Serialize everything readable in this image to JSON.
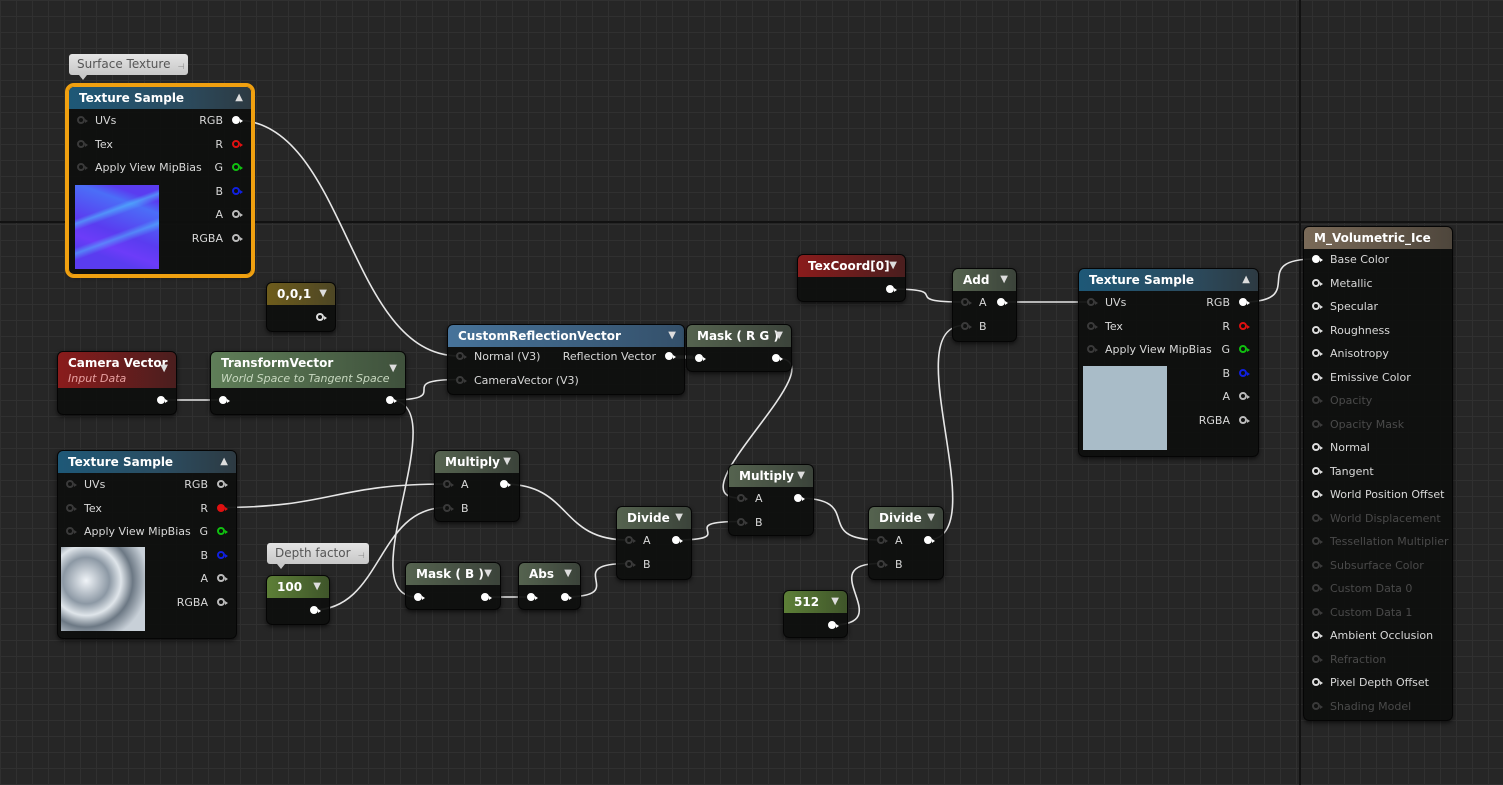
{
  "editor": {
    "type": "material-graph"
  },
  "colors": {
    "selection": "#f0a010",
    "wire": "#e6e6e6",
    "background": "#262626"
  },
  "nodes": [
    {
      "id": "ts1",
      "kind": "texture",
      "title": "Texture Sample",
      "comment": "Surface Texture",
      "selected": true,
      "collapse_icon": "triangle-up-icon",
      "inputs": [
        {
          "label": "UVs"
        },
        {
          "label": "Tex"
        },
        {
          "label": "Apply View MipBias"
        }
      ],
      "outputs": [
        {
          "label": "RGB",
          "color": "white",
          "connected": true
        },
        {
          "label": "R",
          "color": "red"
        },
        {
          "label": "G",
          "color": "green"
        },
        {
          "label": "B",
          "color": "blue"
        },
        {
          "label": "A",
          "color": "gray"
        },
        {
          "label": "RGBA",
          "color": "gray"
        }
      ],
      "preview": "normal-map"
    },
    {
      "id": "c001",
      "kind": "const3",
      "title": "0,0,1",
      "inputs": [],
      "outputs": [
        {
          "label": "",
          "color": "white"
        }
      ]
    },
    {
      "id": "cam",
      "kind": "red",
      "title": "Camera Vector",
      "subtitle": "Input Data",
      "inputs": [],
      "outputs": [
        {
          "label": "",
          "color": "white",
          "connected": true
        }
      ]
    },
    {
      "id": "tv",
      "kind": "green",
      "title": "TransformVector",
      "subtitle": "World Space to Tangent Space",
      "inputs": [
        {
          "label": "",
          "connected": true
        }
      ],
      "outputs": [
        {
          "label": "",
          "color": "white",
          "connected": true
        }
      ]
    },
    {
      "id": "crv",
      "kind": "crv",
      "title": "CustomReflectionVector",
      "inputs": [
        {
          "label": "Normal (V3)"
        },
        {
          "label": "CameraVector (V3)"
        }
      ],
      "outputs": [
        {
          "label": "Reflection Vector",
          "color": "white",
          "connected": true
        }
      ]
    },
    {
      "id": "maskrg",
      "kind": "math",
      "title": "Mask ( R G )",
      "inputs": [
        {
          "label": "",
          "connected": true
        }
      ],
      "outputs": [
        {
          "label": "",
          "color": "white",
          "connected": true
        }
      ]
    },
    {
      "id": "texcoord",
      "kind": "red",
      "title": "TexCoord[0]",
      "inputs": [],
      "outputs": [
        {
          "label": "",
          "color": "white",
          "connected": true
        }
      ]
    },
    {
      "id": "add",
      "kind": "math",
      "title": "Add",
      "inputs": [
        {
          "label": "A"
        },
        {
          "label": "B"
        }
      ],
      "outputs": [
        {
          "label": "",
          "color": "white",
          "connected": true
        }
      ]
    },
    {
      "id": "ts2",
      "kind": "texture",
      "title": "Texture Sample",
      "collapse_icon": "triangle-up-icon",
      "inputs": [
        {
          "label": "UVs"
        },
        {
          "label": "Tex"
        },
        {
          "label": "Apply View MipBias"
        }
      ],
      "outputs": [
        {
          "label": "RGB",
          "color": "white",
          "connected": true
        },
        {
          "label": "R",
          "color": "red"
        },
        {
          "label": "G",
          "color": "green"
        },
        {
          "label": "B",
          "color": "blue"
        },
        {
          "label": "A",
          "color": "gray"
        },
        {
          "label": "RGBA",
          "color": "gray"
        }
      ],
      "preview": "flat-blue-gray"
    },
    {
      "id": "ts3",
      "kind": "texture",
      "title": "Texture Sample",
      "collapse_icon": "triangle-up-icon",
      "inputs": [
        {
          "label": "UVs"
        },
        {
          "label": "Tex"
        },
        {
          "label": "Apply View MipBias"
        }
      ],
      "outputs": [
        {
          "label": "RGB",
          "color": "gray"
        },
        {
          "label": "R",
          "color": "red",
          "connected": true
        },
        {
          "label": "G",
          "color": "green"
        },
        {
          "label": "B",
          "color": "blue"
        },
        {
          "label": "A",
          "color": "gray"
        },
        {
          "label": "RGBA",
          "color": "gray"
        }
      ],
      "preview": "ice"
    },
    {
      "id": "c100",
      "kind": "const1",
      "title": "100",
      "comment": "Depth factor",
      "inputs": [],
      "outputs": [
        {
          "label": "",
          "color": "white",
          "connected": true
        }
      ]
    },
    {
      "id": "mul1",
      "kind": "math",
      "title": "Multiply",
      "inputs": [
        {
          "label": "A"
        },
        {
          "label": "B"
        }
      ],
      "outputs": [
        {
          "label": "",
          "color": "white",
          "connected": true
        }
      ]
    },
    {
      "id": "maskb",
      "kind": "math",
      "title": "Mask ( B )",
      "inputs": [
        {
          "label": "",
          "connected": true
        }
      ],
      "outputs": [
        {
          "label": "",
          "color": "white",
          "connected": true
        }
      ]
    },
    {
      "id": "abs",
      "kind": "math",
      "title": "Abs",
      "inputs": [
        {
          "label": "",
          "connected": true
        }
      ],
      "outputs": [
        {
          "label": "",
          "color": "white",
          "connected": true
        }
      ]
    },
    {
      "id": "div1",
      "kind": "math",
      "title": "Divide",
      "inputs": [
        {
          "label": "A"
        },
        {
          "label": "B"
        }
      ],
      "outputs": [
        {
          "label": "",
          "color": "white",
          "connected": true
        }
      ]
    },
    {
      "id": "mul2",
      "kind": "math",
      "title": "Multiply",
      "inputs": [
        {
          "label": "A"
        },
        {
          "label": "B"
        }
      ],
      "outputs": [
        {
          "label": "",
          "color": "white",
          "connected": true
        }
      ]
    },
    {
      "id": "div2",
      "kind": "math",
      "title": "Divide",
      "inputs": [
        {
          "label": "A"
        },
        {
          "label": "B"
        }
      ],
      "outputs": [
        {
          "label": "",
          "color": "white",
          "connected": true
        }
      ]
    },
    {
      "id": "c512",
      "kind": "const1",
      "title": "512",
      "inputs": [],
      "outputs": [
        {
          "label": "",
          "color": "white",
          "connected": true
        }
      ]
    },
    {
      "id": "out",
      "kind": "output",
      "title": "M_Volumetric_Ice",
      "inputs": [
        {
          "label": "Base Color",
          "connected": true
        },
        {
          "label": "Metallic"
        },
        {
          "label": "Specular"
        },
        {
          "label": "Roughness"
        },
        {
          "label": "Anisotropy"
        },
        {
          "label": "Emissive Color"
        },
        {
          "label": "Opacity",
          "disabled": true
        },
        {
          "label": "Opacity Mask",
          "disabled": true
        },
        {
          "label": "Normal"
        },
        {
          "label": "Tangent"
        },
        {
          "label": "World Position Offset"
        },
        {
          "label": "World Displacement",
          "disabled": true
        },
        {
          "label": "Tessellation Multiplier",
          "disabled": true
        },
        {
          "label": "Subsurface Color",
          "disabled": true
        },
        {
          "label": "Custom Data 0",
          "disabled": true
        },
        {
          "label": "Custom Data 1",
          "disabled": true
        },
        {
          "label": "Ambient Occlusion"
        },
        {
          "label": "Refraction",
          "disabled": true
        },
        {
          "label": "Pixel Depth Offset"
        },
        {
          "label": "Shading Model",
          "disabled": true
        }
      ],
      "outputs": []
    }
  ],
  "connections": [
    [
      "ts1",
      "RGB",
      "crv",
      "Normal (V3)"
    ],
    [
      "cam",
      "out",
      "tv",
      "in"
    ],
    [
      "tv",
      "out",
      "crv",
      "CameraVector (V3)"
    ],
    [
      "tv",
      "out",
      "maskb",
      "in"
    ],
    [
      "ts3",
      "R",
      "mul1",
      "A"
    ],
    [
      "c100",
      "out",
      "mul1",
      "B"
    ],
    [
      "mul1",
      "out",
      "div1",
      "A"
    ],
    [
      "maskb",
      "out",
      "abs",
      "in"
    ],
    [
      "abs",
      "out",
      "div1",
      "B"
    ],
    [
      "crv",
      "Reflection Vector",
      "maskrg",
      "in"
    ],
    [
      "maskrg",
      "out",
      "mul2",
      "A"
    ],
    [
      "div1",
      "out",
      "mul2",
      "B"
    ],
    [
      "mul2",
      "out",
      "div2",
      "A"
    ],
    [
      "c512",
      "out",
      "div2",
      "B"
    ],
    [
      "div2",
      "out",
      "add",
      "B"
    ],
    [
      "texcoord",
      "out",
      "add",
      "A"
    ],
    [
      "add",
      "out",
      "ts2",
      "UVs"
    ],
    [
      "ts2",
      "RGB",
      "out",
      "Base Color"
    ]
  ]
}
